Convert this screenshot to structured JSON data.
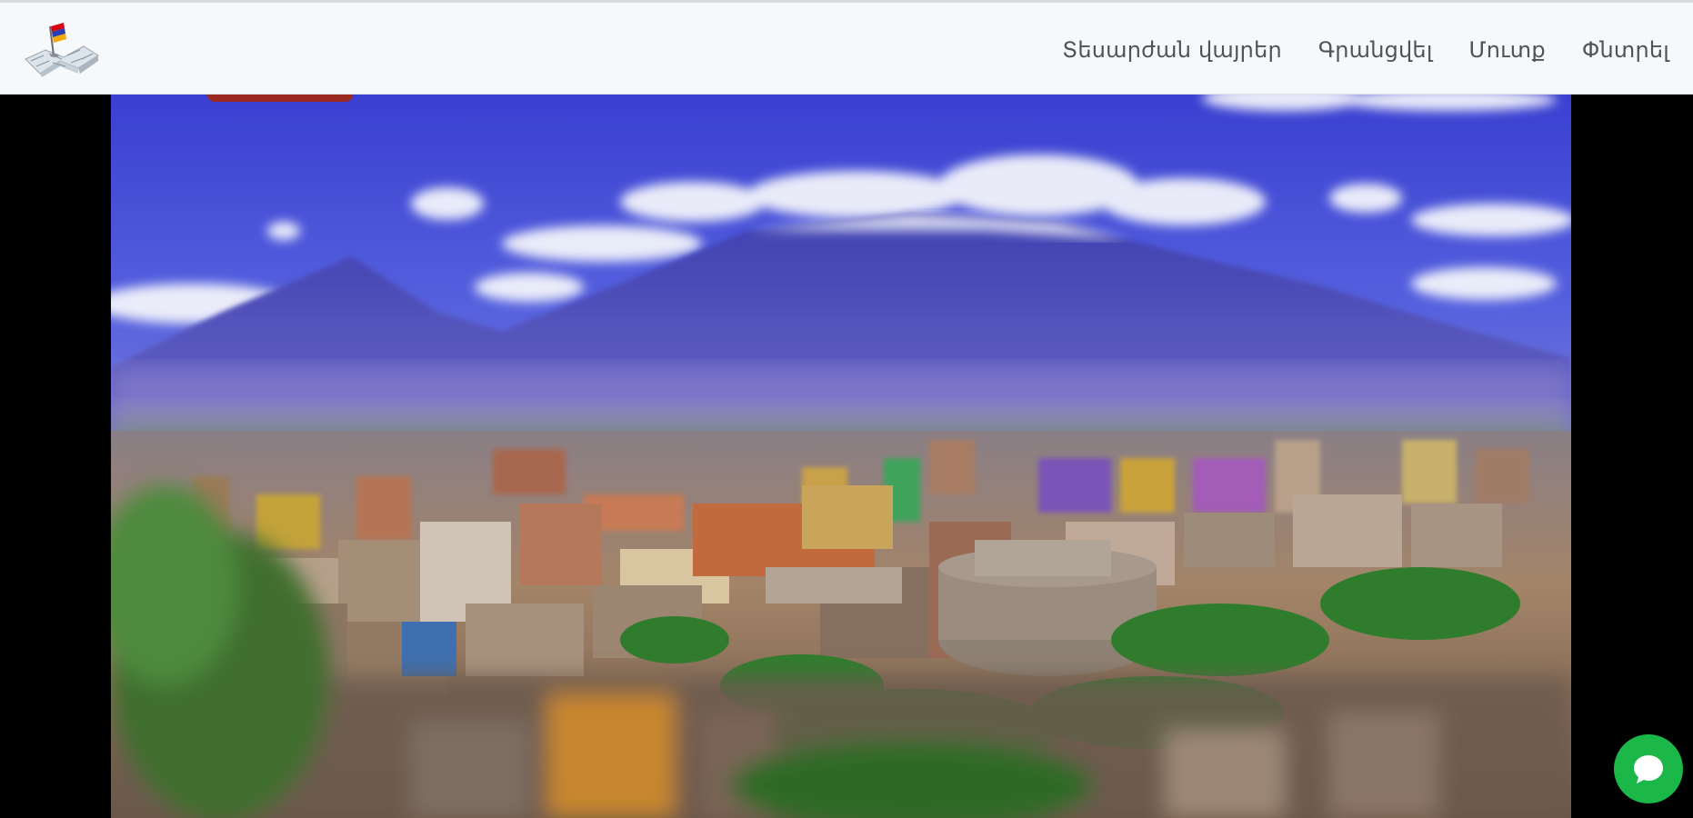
{
  "navbar": {
    "logo_icon": "map-with-armenian-flag-logo",
    "links": [
      {
        "label": "Տեսարժան վայրեր"
      },
      {
        "label": "Գրանցվել"
      },
      {
        "label": "Մուտք"
      },
      {
        "label": "Փնտրել"
      }
    ]
  },
  "hero": {
    "image": "Yerevan city panorama with Mount Ararat",
    "badge_color": "#9b2a22"
  },
  "chat": {
    "icon": "chat-bubble-icon",
    "color": "#1bb749"
  },
  "colors": {
    "navbar_bg": "#f7f8f9",
    "nav_text": "#4f5357",
    "page_bg": "#000000"
  }
}
